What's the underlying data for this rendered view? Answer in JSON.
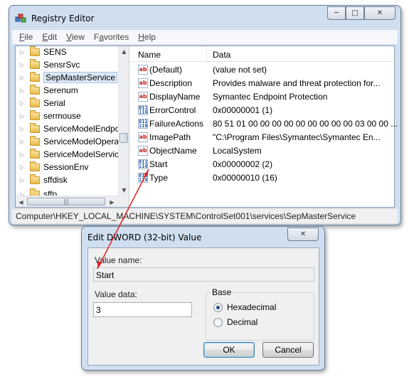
{
  "window": {
    "title": "Registry Editor",
    "controls": {
      "minimize": "─",
      "maximize": "□",
      "close": "✕"
    }
  },
  "menu": [
    {
      "key": "F",
      "rest": "ile"
    },
    {
      "key": "E",
      "rest": "dit"
    },
    {
      "key": "V",
      "rest": "iew"
    },
    {
      "key": "",
      "pre": "F",
      "keymid": "a",
      "rest": "vorites"
    },
    {
      "key": "H",
      "rest": "elp"
    }
  ],
  "tree": {
    "items": [
      {
        "label": "SENS"
      },
      {
        "label": "SensrSvc"
      },
      {
        "label": "SepMasterService",
        "selected": true
      },
      {
        "label": "Serenum"
      },
      {
        "label": "Serial"
      },
      {
        "label": "sermouse"
      },
      {
        "label": "ServiceModelEndpo"
      },
      {
        "label": "ServiceModelOperat"
      },
      {
        "label": "ServiceModelService"
      },
      {
        "label": "SessionEnv"
      },
      {
        "label": "sffdisk"
      },
      {
        "label": "sffp..."
      }
    ]
  },
  "values_list": {
    "headers": {
      "name": "Name",
      "data": "Data"
    },
    "rows": [
      {
        "name": "(Default)",
        "data": "(value not set)",
        "icon": "string-value-icon"
      },
      {
        "name": "Description",
        "data": "Provides malware and threat protection for...",
        "icon": "string-value-icon"
      },
      {
        "name": "DisplayName",
        "data": "Symantec Endpoint Protection",
        "icon": "string-value-icon"
      },
      {
        "name": "ErrorControl",
        "data": "0x00000001 (1)",
        "icon": "binary-value-icon"
      },
      {
        "name": "FailureActions",
        "data": "80 51 01 00 00 00 00 00 00 00 00 00 03 00 00 ...",
        "icon": "binary-value-icon"
      },
      {
        "name": "ImagePath",
        "data": "\"C:\\Program Files\\Symantec\\Symantec En...",
        "icon": "string-value-icon"
      },
      {
        "name": "ObjectName",
        "data": "LocalSystem",
        "icon": "string-value-icon"
      },
      {
        "name": "Start",
        "data": "0x00000002 (2)",
        "icon": "binary-value-icon"
      },
      {
        "name": "Type",
        "data": "0x00000010 (16)",
        "icon": "binary-value-icon"
      }
    ]
  },
  "status_bar": "Computer\\HKEY_LOCAL_MACHINE\\SYSTEM\\ControlSet001\\services\\SepMasterService",
  "dialog": {
    "title": "Edit DWORD (32-bit) Value",
    "close": "✕",
    "value_name_label": "Value name:",
    "value_name": "Start",
    "value_data_label": "Value data:",
    "value_data": "3",
    "base_label": "Base",
    "hex_label": "Hexadecimal",
    "dec_label": "Decimal",
    "base_selected": "Hexadecimal",
    "ok_label": "OK",
    "cancel_label": "Cancel"
  },
  "colors": {
    "annotation_arrow": "#e02020",
    "window_frame": "#cfdff0"
  }
}
